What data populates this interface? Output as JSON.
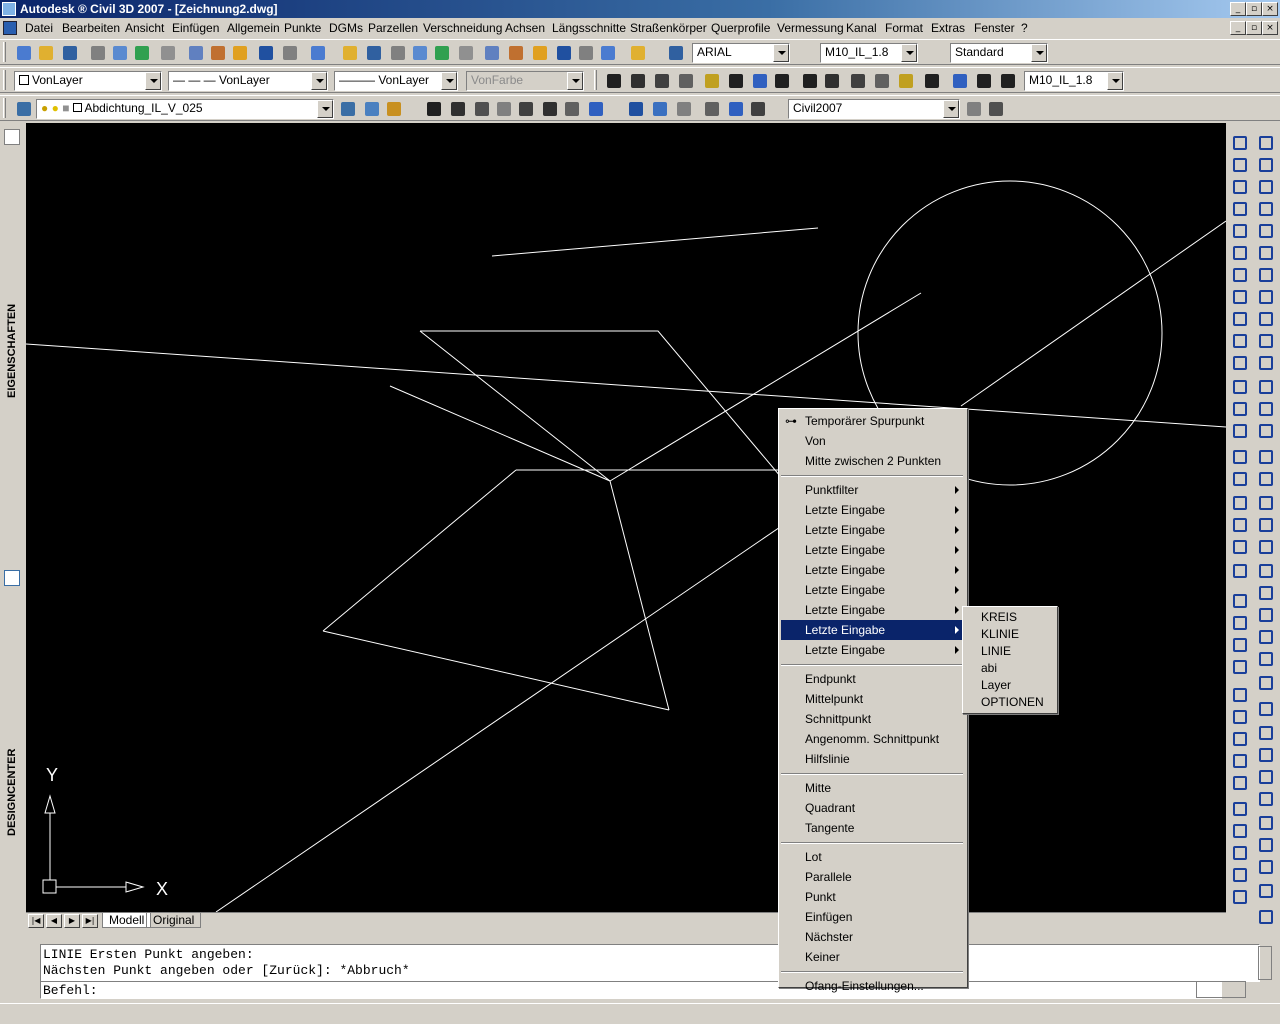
{
  "window": {
    "title": "Autodesk ® Civil 3D 2007 - [Zeichnung2.dwg]"
  },
  "menubar": {
    "items": [
      "Datei",
      "Bearbeiten",
      "Ansicht",
      "Einfügen",
      "Allgemein",
      "Punkte",
      "DGMs",
      "Parzellen",
      "Verschneidung",
      "Achsen",
      "Längsschnitte",
      "Straßenkörper",
      "Querprofile",
      "Vermessung",
      "Kanal",
      "Format",
      "Extras",
      "Fenster",
      "?"
    ]
  },
  "toolbar1": {
    "text_style": "ARIAL",
    "dim_style": "M10_IL_1.8",
    "table_style": "Standard"
  },
  "toolbar2": {
    "color": "VonLayer",
    "linetype": "— — — VonLayer",
    "lineweight": "——— VonLayer",
    "plotstyle": "VonFarbe",
    "dim_style": "M10_IL_1.8"
  },
  "toolbar3": {
    "layer": "Abdichtung_IL_V_025",
    "workspace": "Civil2007"
  },
  "palettes": {
    "properties_label": "EIGENSCHAFTEN",
    "designcenter_label": "DESIGNCENTER"
  },
  "ucs": {
    "x_label": "X",
    "y_label": "Y"
  },
  "tabs": [
    "Modell",
    "Original"
  ],
  "command": {
    "history": [
      "LINIE Ersten Punkt angeben:",
      "Nächsten Punkt angeben oder [Zurück]: *Abbruch*"
    ],
    "prompt": "Befehl:"
  },
  "context_menu": {
    "groups": [
      [
        "Temporärer Spurpunkt",
        "Von",
        "Mitte zwischen 2 Punkten"
      ],
      [
        "Punktfilter",
        "Letzte Eingabe",
        "Letzte Eingabe",
        "Letzte Eingabe",
        "Letzte Eingabe",
        "Letzte Eingabe",
        "Letzte Eingabe",
        "Letzte Eingabe",
        "Letzte Eingabe"
      ],
      [
        "Endpunkt",
        "Mittelpunkt",
        "Schnittpunkt",
        "Angenomm. Schnittpunkt",
        "Hilfslinie"
      ],
      [
        "Mitte",
        "Quadrant",
        "Tangente"
      ],
      [
        "Lot",
        "Parallele",
        "Punkt",
        "Einfügen",
        "Nächster",
        "Keiner"
      ],
      [
        "Ofang-Einstellungen..."
      ]
    ],
    "highlighted": "Letzte Eingabe"
  },
  "submenu": {
    "items": [
      "KREIS",
      "KLINIE",
      "LINIE",
      "abi",
      "Layer",
      "OPTIONEN"
    ]
  },
  "colors": {
    "highlight": "#0a246a",
    "canvas": "#000000",
    "geometry": "#ffffff"
  }
}
